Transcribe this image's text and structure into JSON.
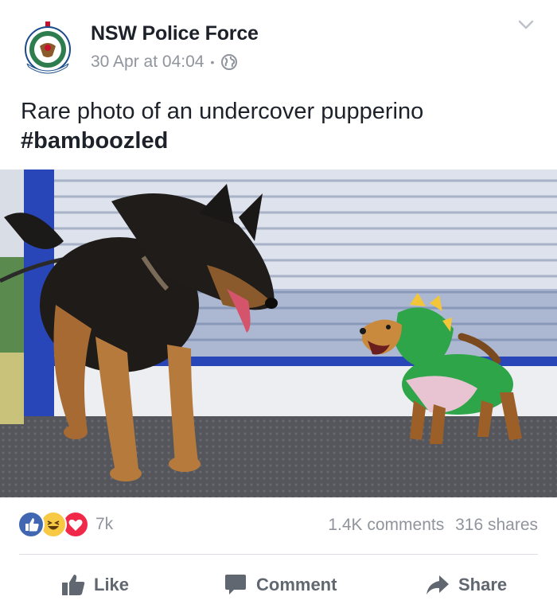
{
  "header": {
    "page_name": "NSW Police Force",
    "timestamp": "30 Apr at 04:04",
    "separator": "•",
    "privacy_icon": "globe-icon",
    "options_icon": "chevron-down-icon"
  },
  "post": {
    "text_line1": "Rare photo of an undercover pupperino",
    "hashtag": "#bamboozled"
  },
  "photo": {
    "subject": "german-shepherd-and-dachshund-in-dinosaur-costume"
  },
  "reactions": {
    "icons": [
      "like-icon",
      "haha-icon",
      "love-icon"
    ],
    "count": "7k",
    "comments": "1.4K comments",
    "shares": "316 shares"
  },
  "actions": {
    "like": "Like",
    "comment": "Comment",
    "share": "Share"
  },
  "colors": {
    "like_blue": "#4267b2",
    "haha_yellow": "#f7c944",
    "love_red": "#f0284a",
    "meta_gray": "#90949c",
    "action_gray": "#606770"
  }
}
